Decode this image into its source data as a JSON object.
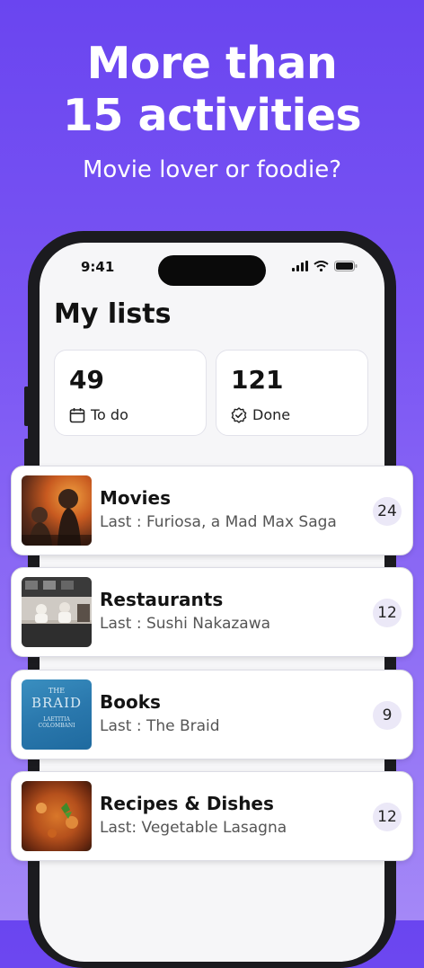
{
  "promo": {
    "headline_line1": "More than",
    "headline_line2": "15 activities",
    "subline": "Movie lover or foodie?"
  },
  "status_bar": {
    "time": "9:41"
  },
  "page": {
    "title": "My lists"
  },
  "stats": [
    {
      "value": "49",
      "label": "To do",
      "icon": "calendar-icon"
    },
    {
      "value": "121",
      "label": "Done",
      "icon": "check-badge-icon"
    }
  ],
  "lists": [
    {
      "title": "Movies",
      "last": "Last : Furiosa, a Mad Max Saga",
      "count": "24",
      "thumb": "movie-poster"
    },
    {
      "title": "Restaurants",
      "last": "Last : Sushi Nakazawa",
      "count": "12",
      "thumb": "restaurant-photo"
    },
    {
      "title": "Books",
      "last": "Last : The Braid",
      "count": "9",
      "thumb": "book-cover",
      "cover": {
        "line1": "THE",
        "line2": "BRAID",
        "author1": "LAETITIA",
        "author2": "COLOMBANI"
      }
    },
    {
      "title": "Recipes & Dishes",
      "last": "Last: Vegetable Lasagna",
      "count": "12",
      "thumb": "lasagna-photo"
    }
  ],
  "colors": {
    "accent": "#6a45f0",
    "badge_bg": "#ebe8f7"
  }
}
